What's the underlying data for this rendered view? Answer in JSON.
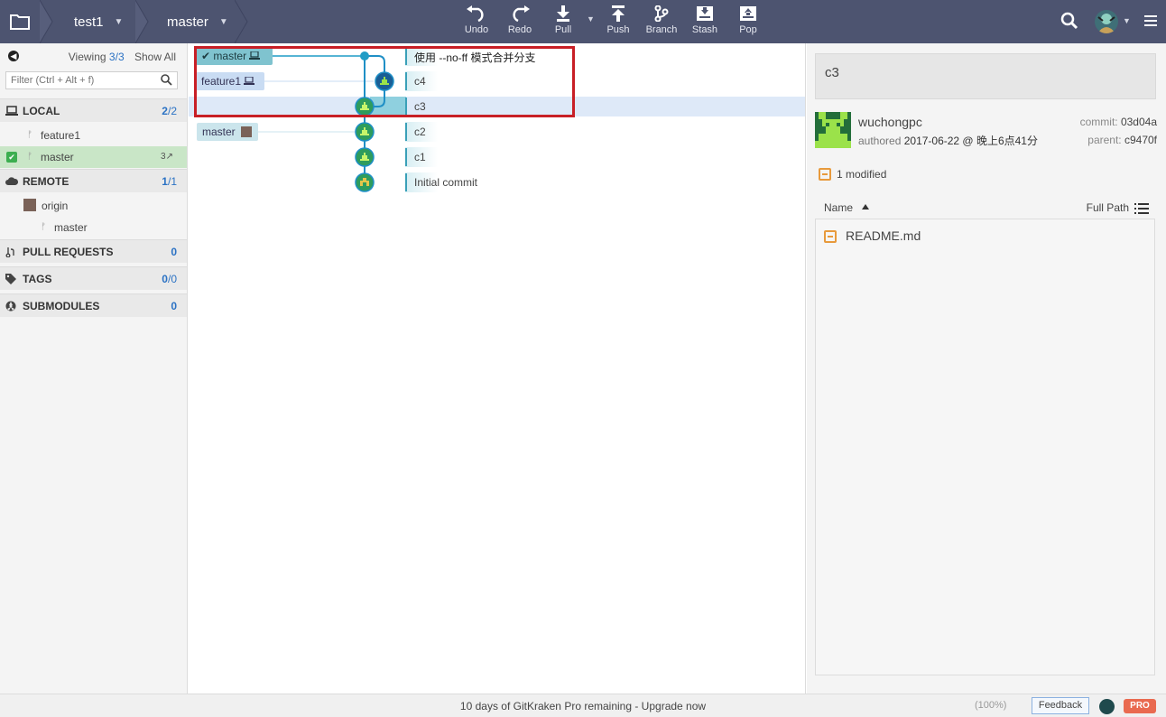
{
  "topbar": {
    "repo": "test1",
    "branch": "master",
    "tools": [
      {
        "label": "Undo",
        "icon": "undo-icon"
      },
      {
        "label": "Redo",
        "icon": "redo-icon"
      },
      {
        "label": "Pull",
        "icon": "pull-icon"
      },
      {
        "label": "Push",
        "icon": "push-icon"
      },
      {
        "label": "Branch",
        "icon": "branch-icon"
      },
      {
        "label": "Stash",
        "icon": "stash-icon"
      },
      {
        "label": "Pop",
        "icon": "pop-icon"
      }
    ]
  },
  "left": {
    "viewing_label": "Viewing",
    "viewing_count": "3",
    "viewing_total": "/3",
    "show_all": "Show All",
    "filter_placeholder": "Filter (Ctrl + Alt + f)",
    "local": {
      "title": "LOCAL",
      "count": "2",
      "total": "/2",
      "branches": [
        {
          "name": "feature1"
        },
        {
          "name": "master",
          "ahead": "3↗",
          "checked": true
        }
      ]
    },
    "remote": {
      "title": "REMOTE",
      "count": "1",
      "total": "/1",
      "remotes": [
        {
          "name": "origin",
          "branches": [
            {
              "name": "master"
            }
          ]
        }
      ]
    },
    "pull_requests": {
      "title": "PULL REQUESTS",
      "count": "0"
    },
    "tags": {
      "title": "TAGS",
      "count": "0",
      "total": "/0"
    },
    "submodules": {
      "title": "SUBMODULES",
      "count": "0"
    }
  },
  "graph": {
    "refs": {
      "master_local": "master",
      "feature1": "feature1",
      "master_remote": "master"
    },
    "commits": [
      {
        "message": "使用 --no-ff 模式合并分支"
      },
      {
        "message": "c4"
      },
      {
        "message": "c3"
      },
      {
        "message": "c2"
      },
      {
        "message": "c1"
      },
      {
        "message": "Initial commit"
      }
    ]
  },
  "detail": {
    "message": "c3",
    "author": "wuchongpc",
    "authored_label": "authored",
    "authored_date": "2017-06-22 @ 晚上6点41分",
    "commit_label": "commit:",
    "commit_sha": "03d04a",
    "parent_label": "parent:",
    "parent_sha": "c9470f",
    "modified": "1 modified",
    "col_name": "Name",
    "col_path": "Full Path",
    "files": [
      {
        "name": "README.md"
      }
    ]
  },
  "status": {
    "text": "10 days of GitKraken Pro remaining - Upgrade now",
    "zoom": "(100%)",
    "feedback": "Feedback",
    "pro": "PRO"
  },
  "colors": {
    "toolbar": "#4d5470",
    "branch_line": "#1f8fc6",
    "node_green": "#2e9c5d",
    "highlight": "#c81f26"
  }
}
